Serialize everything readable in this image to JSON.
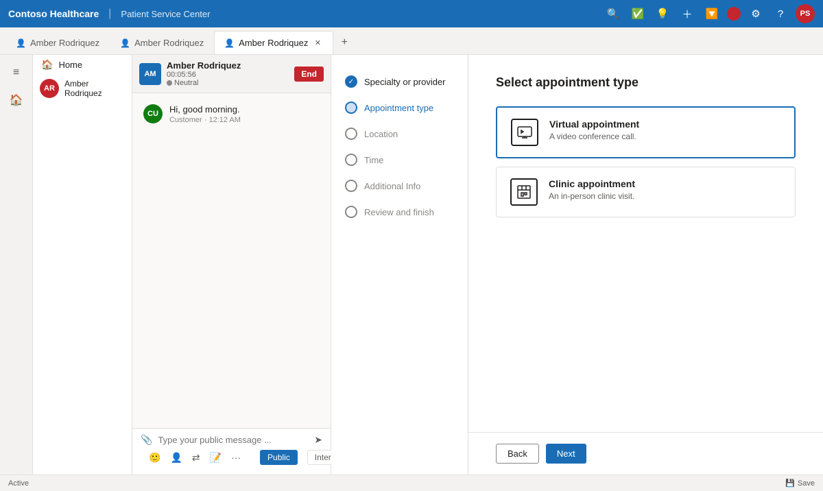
{
  "app": {
    "brand": "Contoso Healthcare",
    "divider": "|",
    "subtitle": "Patient Service Center"
  },
  "topbar": {
    "icons": [
      "search",
      "check-circle",
      "lightbulb",
      "plus",
      "filter",
      "notification",
      "settings",
      "help"
    ],
    "avatar_initials": "PS"
  },
  "tabs": [
    {
      "id": "tab1",
      "label": "Amber Rodriquez",
      "active": false,
      "closable": true
    },
    {
      "id": "tab2",
      "label": "Amber Rodriquez",
      "active": false,
      "closable": false
    },
    {
      "id": "tab3",
      "label": "Amber Rodriquez",
      "active": true,
      "closable": true
    }
  ],
  "sidebar_nav": {
    "menu_icon": "≡",
    "home_label": "Home",
    "agent_name": "Amber Rodriquez",
    "agent_initials": "AR"
  },
  "call": {
    "caller_initials": "AM",
    "caller_name": "Amber Rodriquez",
    "timer": "00:05:56",
    "status": "Neutral",
    "end_label": "End"
  },
  "wizard": {
    "steps": [
      {
        "id": "specialty",
        "label": "Specialty or provider",
        "state": "completed"
      },
      {
        "id": "appointment",
        "label": "Appointment type",
        "state": "active"
      },
      {
        "id": "location",
        "label": "Location",
        "state": "inactive"
      },
      {
        "id": "time",
        "label": "Time",
        "state": "inactive"
      },
      {
        "id": "additional",
        "label": "Additional Info",
        "state": "inactive"
      },
      {
        "id": "review",
        "label": "Review and finish",
        "state": "inactive"
      }
    ]
  },
  "appointment_selection": {
    "title": "Select appointment type",
    "options": [
      {
        "id": "virtual",
        "title": "Virtual appointment",
        "description": "A video conference call.",
        "icon": "💬",
        "selected": true
      },
      {
        "id": "clinic",
        "title": "Clinic appointment",
        "description": "An in-person clinic visit.",
        "icon": "🏥",
        "selected": false
      }
    ],
    "back_label": "Back",
    "next_label": "Next"
  },
  "chat": {
    "messages": [
      {
        "avatar_initials": "CU",
        "avatar_bg": "#107c10",
        "text": "Hi, good morning.",
        "meta": "Customer · 12:12 AM"
      }
    ],
    "input_placeholder": "Type your public message ...",
    "send_icon": "➤",
    "attach_icon": "📎",
    "toolbar_icons": [
      "😊",
      "👤",
      "⇄",
      "📝",
      "···"
    ],
    "visibility_options": [
      {
        "label": "Public",
        "active": true
      },
      {
        "label": "Internal",
        "active": false
      }
    ]
  },
  "statusbar": {
    "status": "Active",
    "save_label": "Save",
    "save_icon": "💾"
  }
}
